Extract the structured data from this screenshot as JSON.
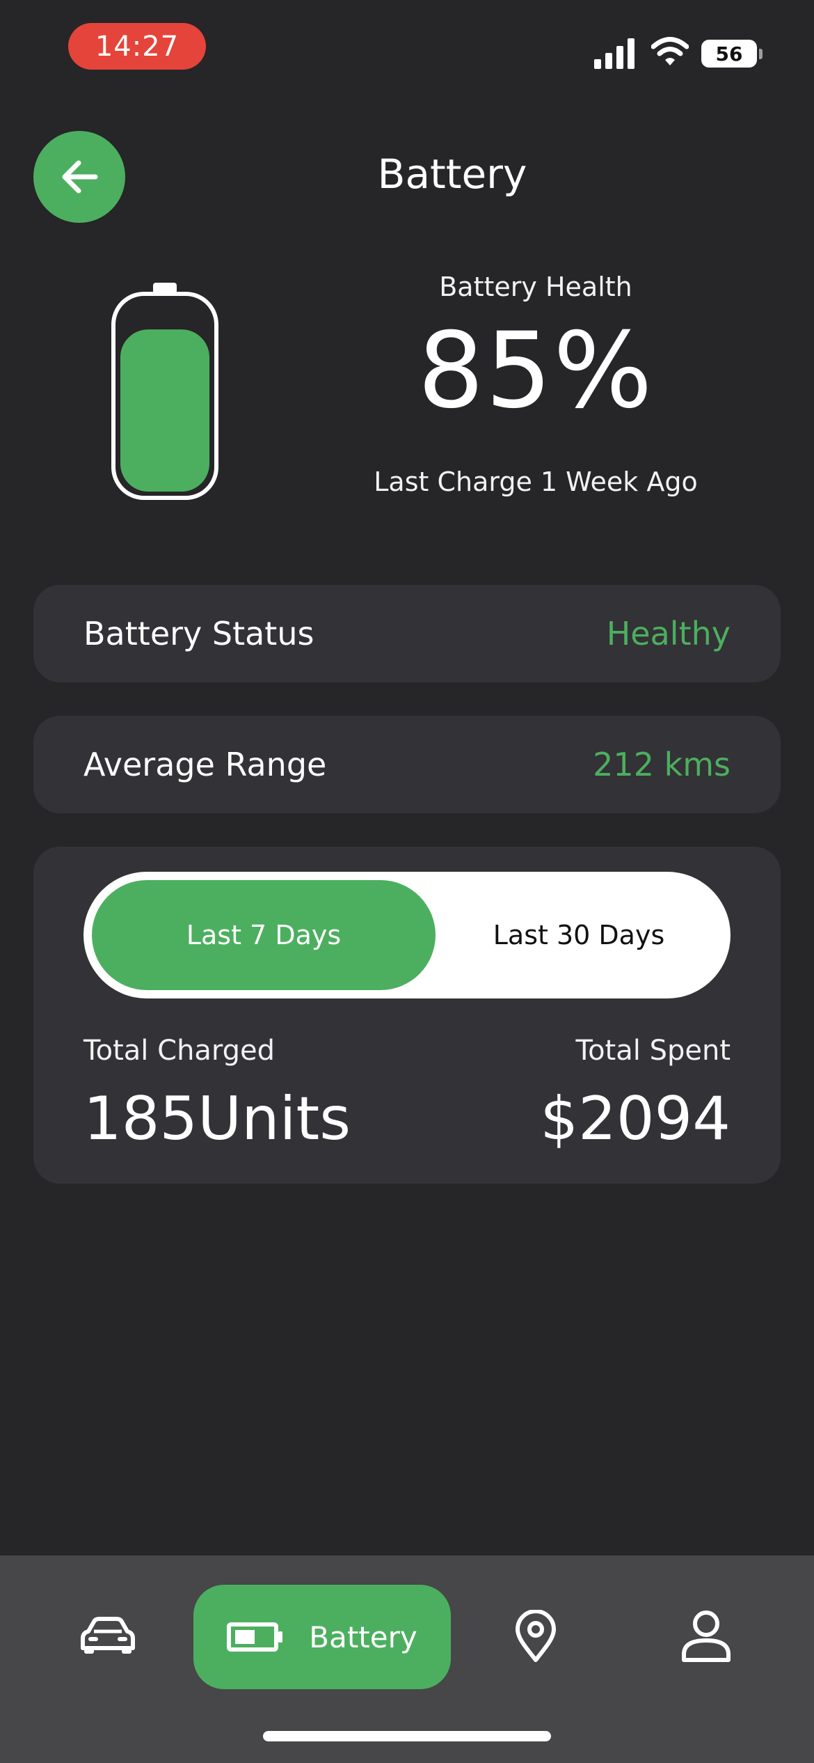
{
  "status_bar": {
    "time": "14:27",
    "battery_level": "56",
    "icons": [
      "signal-icon",
      "wifi-icon",
      "battery-icon"
    ]
  },
  "header": {
    "title": "Battery",
    "back_icon": "arrow-left-icon"
  },
  "health": {
    "label": "Battery Health",
    "value": "85%",
    "fill_level_percent": 85,
    "last_charge": "Last Charge 1 Week Ago"
  },
  "status_row": {
    "label": "Battery Status",
    "value": "Healthy"
  },
  "range_row": {
    "label": "Average Range",
    "value": "212 kms"
  },
  "period_toggle": {
    "options": [
      "Last 7 Days",
      "Last 30 Days"
    ],
    "selected": "Last 7 Days"
  },
  "stats": {
    "charged_label": "Total Charged",
    "charged_value": "185Units",
    "spent_label": "Total Spent",
    "spent_value": "$2094"
  },
  "bottom_nav": {
    "items": [
      {
        "icon": "car-icon",
        "label": ""
      },
      {
        "icon": "battery-icon",
        "label": "Battery"
      },
      {
        "icon": "location-pin-icon",
        "label": ""
      },
      {
        "icon": "user-icon",
        "label": ""
      }
    ],
    "active_index": 1
  },
  "colors": {
    "background": "#262528",
    "card": "#333236",
    "accent": "#4caf5f",
    "nav_background": "#474649",
    "time_pill": "#e5443a"
  }
}
